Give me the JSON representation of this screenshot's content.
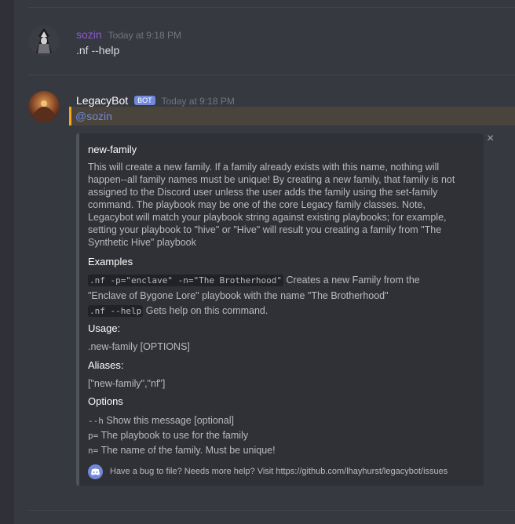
{
  "colors": {
    "user": "#8e59d5",
    "bot": "#ffffff",
    "mention": "#7289da",
    "embed_accent": "#4f545c"
  },
  "messages": [
    {
      "username": "sozin",
      "timestamp": "Today at 9:18 PM",
      "content": ".nf --help"
    },
    {
      "username": "LegacyBot",
      "badge": "BOT",
      "timestamp": "Today at 9:18 PM",
      "mention": "@sozin"
    }
  ],
  "embed": {
    "close_icon": "×",
    "title": "new-family",
    "description": [
      "This will create a new family. If a family already exists with this name, nothing will",
      "happen--all family names must be unique! By creating a new family, that family is not",
      "assigned to the Discord user unless the user adds the family using the set-family",
      "command. The playbook may be one of the core Legacy family classes. Note,",
      "Legacybot will match your playbook string against existing playbooks; for example,",
      "setting your playbook to \"hive\" or \"Hive\" will result you creating a family from \"The",
      "Synthetic Hive\" playbook"
    ],
    "examples_label": "Examples",
    "examples": [
      {
        "code": ".nf -p=\"enclave\" -n=\"The Brotherhood\"",
        "text": "Creates a new Family from the",
        "text2": "\"Enclave of Bygone Lore\" playbook with the name \"The Brotherhood\""
      },
      {
        "code": ".nf --help",
        "text": "Gets help on this command."
      }
    ],
    "usage_label": "Usage:",
    "usage_value": ".new-family [OPTIONS]",
    "aliases_label": "Aliases:",
    "aliases_value": "[\"new-family\",\"nf\"]",
    "options_label": "Options",
    "options": [
      {
        "flag": "--h",
        "text": "Show this message [optional]"
      },
      {
        "flag": "p=",
        "text": "The playbook to use for the family"
      },
      {
        "flag": "n=",
        "text": "The name of the family. Must be unique!"
      }
    ],
    "footer": "Have a bug to file? Needs more help? Visit https://github.com/lhayhurst/legacybot/issues"
  }
}
